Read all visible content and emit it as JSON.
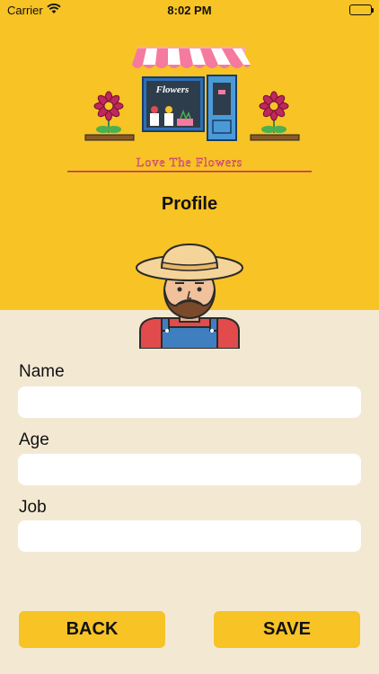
{
  "status_bar": {
    "carrier": "Carrier",
    "time": "8:02 PM",
    "wifi_icon": "wifi-icon",
    "battery_icon": "battery-icon"
  },
  "header": {
    "logo_sign_text": "Flowers",
    "logo_tagline": "Love The Flowers",
    "title": "Profile"
  },
  "form": {
    "fields": [
      {
        "label": "Name",
        "value": "",
        "placeholder": ""
      },
      {
        "label": "Age",
        "value": "",
        "placeholder": ""
      },
      {
        "label": "Job",
        "value": "",
        "placeholder": ""
      }
    ]
  },
  "actions": {
    "back_label": "BACK",
    "save_label": "SAVE"
  },
  "colors": {
    "header_bg": "#F7C325",
    "body_bg": "#F3E9D3",
    "button_bg": "#F7C325",
    "input_bg": "#FFFFFF"
  }
}
